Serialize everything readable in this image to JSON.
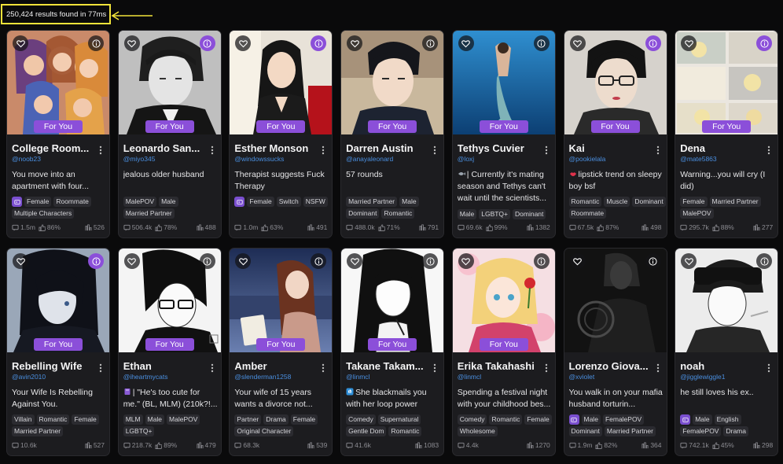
{
  "results_text": "250,424 results found in 77ms",
  "colors": {
    "accent": "#8b4fd9",
    "author": "#4a8fe0",
    "highlight": "#f2e33a"
  },
  "badge_label": "For You",
  "cards": [
    {
      "title": "College Room...",
      "author": "@noob23",
      "desc": "You move into an apartment with four...",
      "emoji": "",
      "tag_icon": true,
      "tags": [
        "Female",
        "Roommate",
        "Multiple Characters"
      ],
      "chats": "1.5m",
      "likes": "86%",
      "count": "526",
      "info_purple": false
    },
    {
      "title": "Leonardo San...",
      "author": "@miyo345",
      "desc": "jealous older husband",
      "emoji": "",
      "tag_icon": false,
      "tags": [
        "MalePOV",
        "Male",
        "Married Partner"
      ],
      "chats": "506.4k",
      "likes": "78%",
      "count": "488",
      "info_purple": true
    },
    {
      "title": "Esther Monson",
      "author": "@windowssucks",
      "desc": "Therapist suggests Fuck Therapy",
      "emoji": "",
      "tag_icon": true,
      "tags": [
        "Female",
        "Switch",
        "NSFW"
      ],
      "chats": "1.0m",
      "likes": "63%",
      "count": "491",
      "info_purple": true
    },
    {
      "title": "Darren Austin",
      "author": "@anayaleonard",
      "desc": "57 rounds",
      "emoji": "",
      "tag_icon": false,
      "tags": [
        "Married Partner",
        "Male",
        "Dominant",
        "Romantic"
      ],
      "chats": "488.0k",
      "likes": "71%",
      "count": "791",
      "info_purple": false
    },
    {
      "title": "Tethys Cuvier",
      "author": "@loxj",
      "desc": "| Currently it's mating season and Tethys can't wait until the scientists...",
      "emoji": "fish",
      "tag_icon": false,
      "tags": [
        "Male",
        "LGBTQ+",
        "Dominant"
      ],
      "chats": "69.6k",
      "likes": "99%",
      "count": "1382",
      "info_purple": false
    },
    {
      "title": "Kai",
      "author": "@pookielala",
      "desc": "lipstick trend on sleepy boy bsf",
      "emoji": "lips",
      "tag_icon": false,
      "tags": [
        "Romantic",
        "Muscle",
        "Dominant",
        "Roommate"
      ],
      "chats": "67.5k",
      "likes": "87%",
      "count": "498",
      "info_purple": true
    },
    {
      "title": "Dena",
      "author": "@mate5863",
      "desc": "Warning...you will cry (I did)",
      "emoji": "",
      "tag_icon": false,
      "tags": [
        "Female",
        "Married Partner",
        "MalePOV"
      ],
      "chats": "295.7k",
      "likes": "88%",
      "count": "277",
      "info_purple": true
    },
    {
      "title": "Rebelling Wife",
      "author": "@avin2010",
      "desc": "Your Wife Is Rebelling Against You.",
      "emoji": "",
      "tag_icon": false,
      "tags": [
        "Villain",
        "Romantic",
        "Female",
        "Married Partner"
      ],
      "chats": "10.6k",
      "likes": "",
      "count": "527",
      "info_purple": true
    },
    {
      "title": "Ethan",
      "author": "@iheartmycats",
      "desc": "| \"He's too cute for me.\" (BL, MLM) (210k?!...",
      "emoji": "book",
      "tag_icon": false,
      "tags": [
        "MLM",
        "Male",
        "MalePOV",
        "LGBTQ+"
      ],
      "chats": "218.7k",
      "likes": "89%",
      "count": "479",
      "info_purple": false
    },
    {
      "title": "Amber",
      "author": "@slenderman1258",
      "desc": "Your wife of 15 years wants a divorce not...",
      "emoji": "",
      "tag_icon": false,
      "tags": [
        "Partner",
        "Drama",
        "Female",
        "Original Character"
      ],
      "chats": "68.3k",
      "likes": "",
      "count": "539",
      "info_purple": false
    },
    {
      "title": "Takane Takam...",
      "author": "@linmcl",
      "desc": "She blackmails you with her loop power",
      "emoji": "loop",
      "tag_icon": false,
      "tags": [
        "Comedy",
        "Supernatural",
        "Gentle Dom",
        "Romantic"
      ],
      "chats": "41.6k",
      "likes": "",
      "count": "1083",
      "info_purple": false
    },
    {
      "title": "Erika Takahashi",
      "author": "@linmcl",
      "desc": "Spending a festival night with your childhood bes...",
      "emoji": "",
      "tag_icon": false,
      "tags": [
        "Comedy",
        "Romantic",
        "Female",
        "Wholesome"
      ],
      "chats": "4.4k",
      "likes": "",
      "count": "1270",
      "info_purple": false
    },
    {
      "title": "Lorenzo Giova...",
      "author": "@xviolet",
      "desc": "You walk in on your mafia husband torturin...",
      "emoji": "",
      "tag_icon": true,
      "tags": [
        "Male",
        "FemalePOV",
        "Dominant",
        "Married Partner"
      ],
      "chats": "1.9m",
      "likes": "82%",
      "count": "364",
      "info_purple": false
    },
    {
      "title": "noah",
      "author": "@jigglewiggle1",
      "desc": "he still loves his ex..",
      "emoji": "",
      "tag_icon": true,
      "tags": [
        "Male",
        "English",
        "FemalePOV",
        "Drama"
      ],
      "chats": "742.1k",
      "likes": "45%",
      "count": "298",
      "info_purple": false
    }
  ]
}
